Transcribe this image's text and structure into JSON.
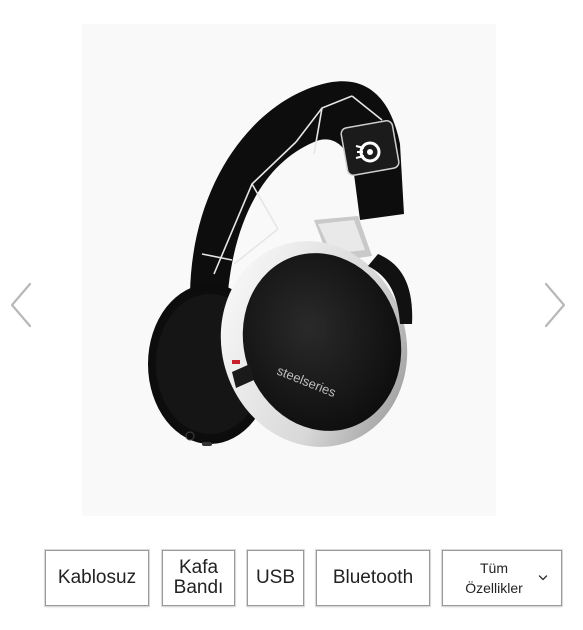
{
  "gallery": {
    "image_alt": "steelseries",
    "brand_print": "steelseries",
    "prev_icon": "chevron-left-icon",
    "next_icon": "chevron-right-icon"
  },
  "features": {
    "items": [
      {
        "label": "Kablosuz"
      },
      {
        "label": "Kafa Bandı"
      },
      {
        "label": "USB"
      },
      {
        "label": "Bluetooth"
      }
    ],
    "all_features_label": "Tüm Özellikler",
    "all_features_icon": "chevron-down-icon"
  },
  "colors": {
    "arrow": "#b8b8b8",
    "chip_border": "#9a9a9a",
    "text": "#222222",
    "image_bg": "#f9f9f9"
  }
}
